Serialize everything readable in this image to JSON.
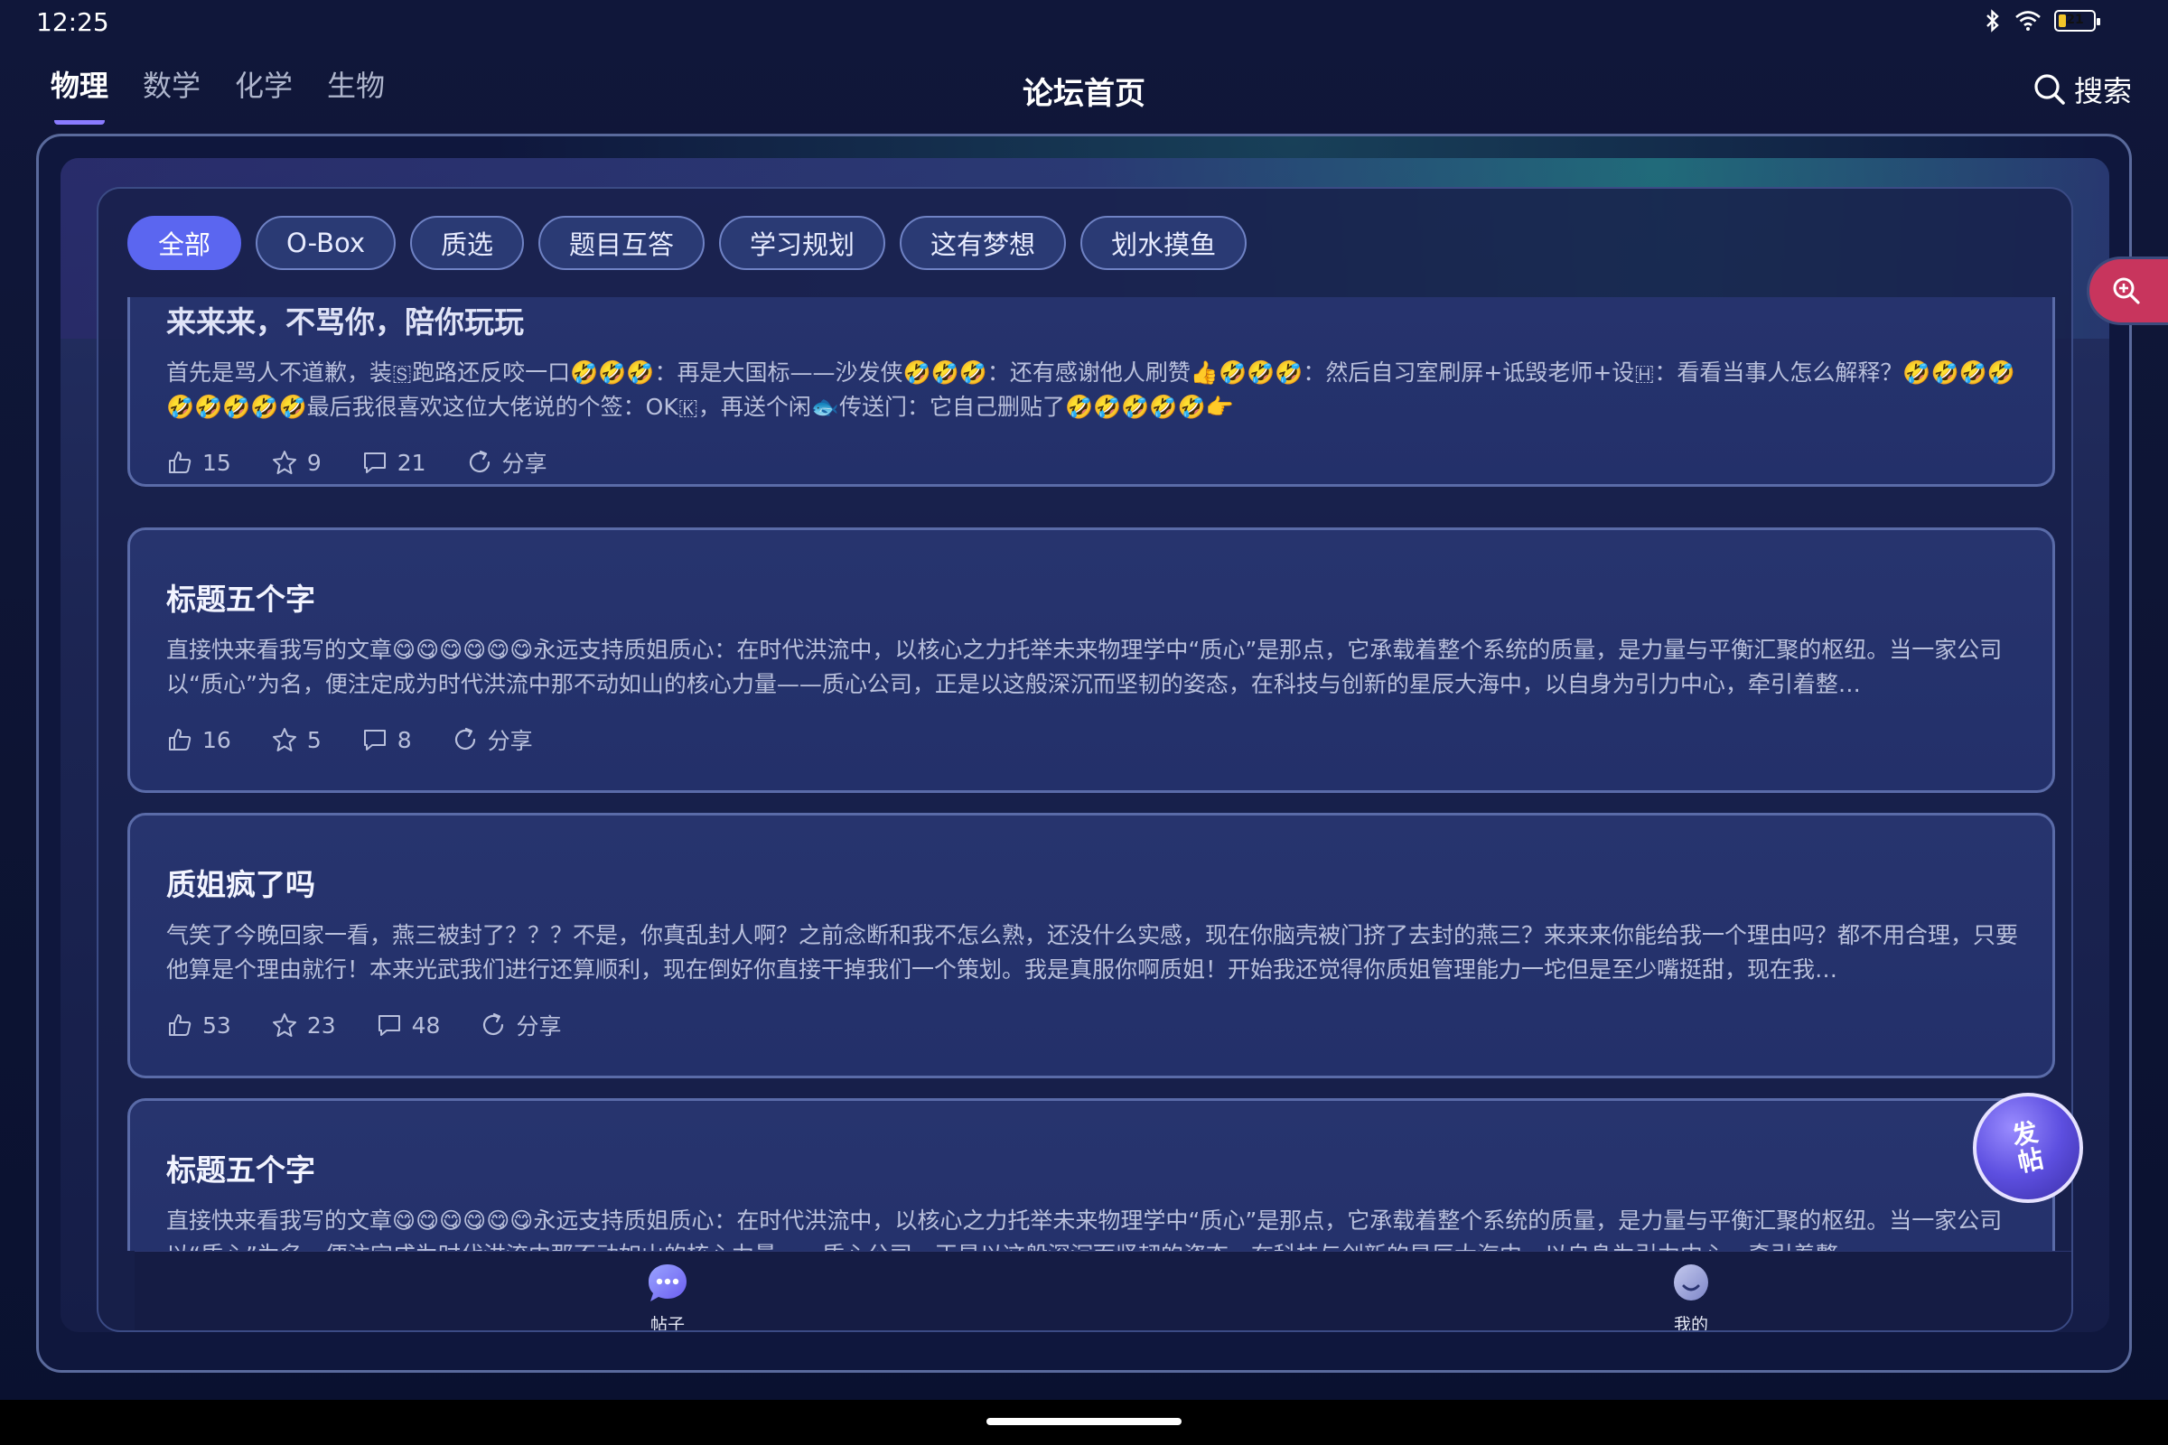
{
  "status": {
    "time": "12:25",
    "battery": "21",
    "battery_level": 0.21
  },
  "header": {
    "subject_tabs": [
      "物理",
      "数学",
      "化学",
      "生物"
    ],
    "active_tab": 0,
    "title": "论坛首页",
    "search_label": "搜索"
  },
  "filters": {
    "chips": [
      "全部",
      "O-Box",
      "质选",
      "题目互答",
      "学习规划",
      "这有梦想",
      "划水摸鱼"
    ],
    "active": 0
  },
  "posts": [
    {
      "title": "来来来，不骂你，陪你玩玩",
      "body": "首先是骂人不道歉，装🇸跑路还反咬一口🤣🤣🤣：再是大国标——沙发侠🤣🤣🤣：还有感谢他人刷赞👍🤣🤣🤣：然后自习室刷屏+诋毁老师+设🇭：看看当事人怎么解释？🤣🤣🤣🤣🤣🤣🤣🤣🤣最后我很喜欢这位大佬说的个签：OK🇰，再送个闲🐟传送门：它自己删贴了🤣🤣🤣🤣🤣👉",
      "likes": "15",
      "stars": "9",
      "comments": "21",
      "share": "分享"
    },
    {
      "title": "标题五个字",
      "body": "直接快来看我写的文章😋😋😋😋😋😋永远支持质姐质心：在时代洪流中，以核心之力托举未来物理学中“质心”是那点，它承载着整个系统的质量，是力量与平衡汇聚的枢纽。当一家公司以“质心”为名，便注定成为时代洪流中那不动如山的核心力量——质心公司，正是以这般深沉而坚韧的姿态，在科技与创新的星辰大海中，以自身为引力中心，牵引着整…",
      "likes": "16",
      "stars": "5",
      "comments": "8",
      "share": "分享"
    },
    {
      "title": "质姐疯了吗",
      "body": "气笑了今晚回家一看，燕三被封了？？？不是，你真乱封人啊？之前念断和我不怎么熟，还没什么实感，现在你脑壳被门挤了去封的燕三？来来来你能给我一个理由吗？都不用合理，只要他算是个理由就行！本来光武我们进行还算顺利，现在倒好你直接干掉我们一个策划。我是真服你啊质姐！开始我还觉得你质姐管理能力一坨但是至少嘴挺甜，现在我…",
      "likes": "53",
      "stars": "23",
      "comments": "48",
      "share": "分享"
    },
    {
      "title": "标题五个字",
      "body": "直接快来看我写的文章😋😋😋😋😋😋永远支持质姐质心：在时代洪流中，以核心之力托举未来物理学中“质心”是那点，它承载着整个系统的质量，是力量与平衡汇聚的枢纽。当一家公司以“质心”为名，便注定成为时代洪流中那不动如山的核心力量——质心公司，正是以这般深沉而坚韧的姿态，在科技与创新的星辰大海中，以自身为引力中心，牵引着整…",
      "likes": "",
      "stars": "",
      "comments": "",
      "share": ""
    }
  ],
  "bottom_nav": {
    "posts_label": "帖子",
    "mine_label": "我的"
  },
  "fab": {
    "label": "发帖"
  },
  "colors": {
    "accent": "#5b66f0",
    "zoom_button": "#c8355d",
    "background": "#0f173d"
  },
  "icons": [
    "bluetooth-icon",
    "wifi-icon",
    "battery-icon",
    "search-icon",
    "like-icon",
    "star-icon",
    "comment-icon",
    "share-icon",
    "zoom-in-icon",
    "chat-bubble-icon",
    "profile-icon"
  ]
}
